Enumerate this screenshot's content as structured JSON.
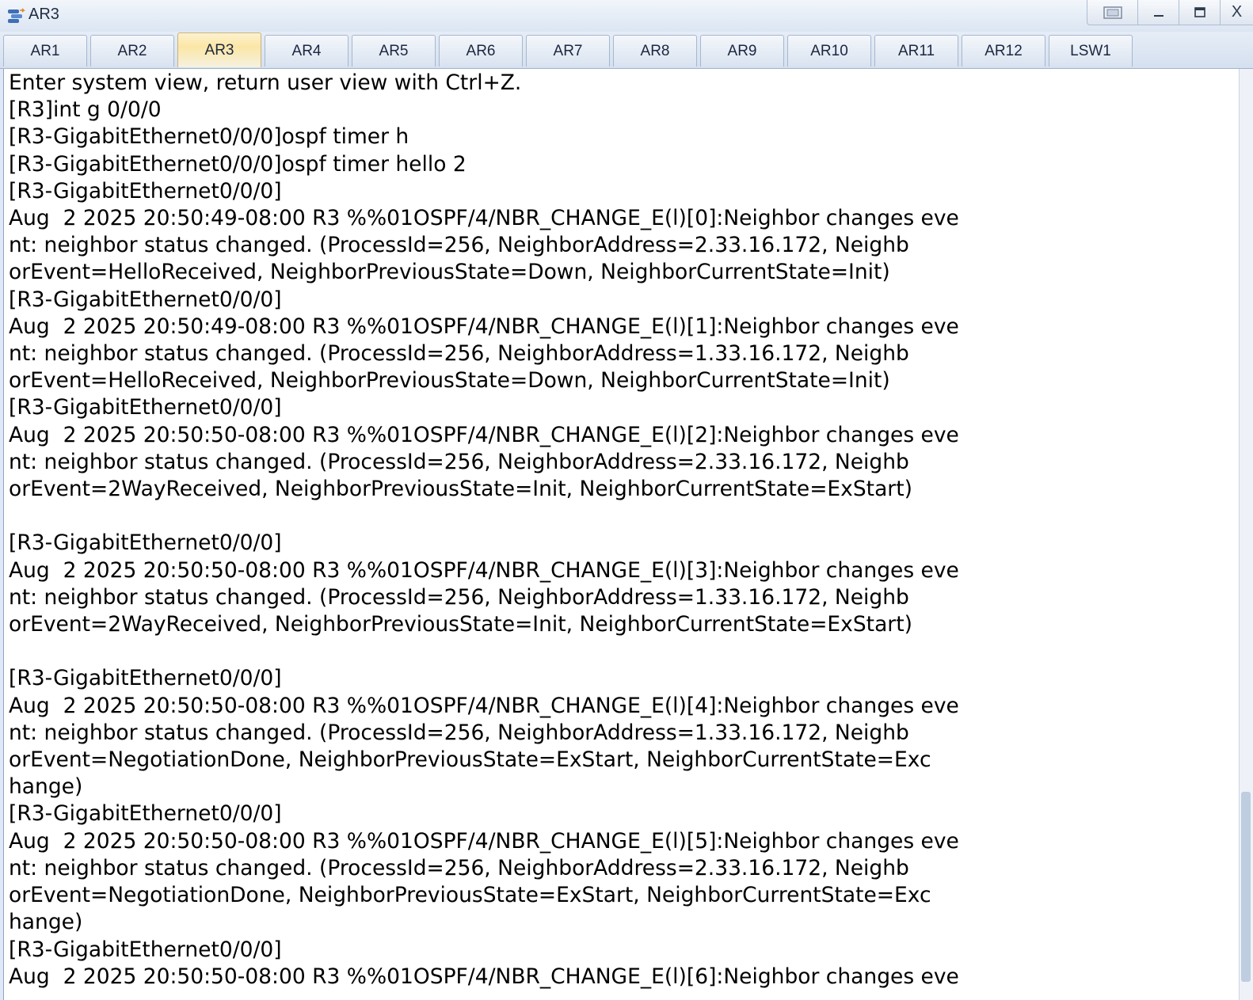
{
  "window": {
    "title": "AR3",
    "icon": "router-icon"
  },
  "window_controls": {
    "restore_icon": "restore-icon",
    "minimize_icon": "minimize-icon",
    "maximize_icon": "maximize-icon",
    "close_label": "X"
  },
  "tabs": [
    {
      "label": "AR1",
      "active": false
    },
    {
      "label": "AR2",
      "active": false
    },
    {
      "label": "AR3",
      "active": true
    },
    {
      "label": "AR4",
      "active": false
    },
    {
      "label": "AR5",
      "active": false
    },
    {
      "label": "AR6",
      "active": false
    },
    {
      "label": "AR7",
      "active": false
    },
    {
      "label": "AR8",
      "active": false
    },
    {
      "label": "AR9",
      "active": false
    },
    {
      "label": "AR10",
      "active": false
    },
    {
      "label": "AR11",
      "active": false
    },
    {
      "label": "AR12",
      "active": false
    },
    {
      "label": "LSW1",
      "active": false
    }
  ],
  "colors": {
    "active_tab": "#fbe6a6",
    "console_background": "#ffffff",
    "console_text": "#000000"
  },
  "console": {
    "lines": [
      "Enter system view, return user view with Ctrl+Z.",
      "[R3]int g 0/0/0",
      "[R3-GigabitEthernet0/0/0]ospf timer h",
      "[R3-GigabitEthernet0/0/0]ospf timer hello 2",
      "[R3-GigabitEthernet0/0/0]",
      "Aug  2 2025 20:50:49-08:00 R3 %%01OSPF/4/NBR_CHANGE_E(l)[0]:Neighbor changes eve",
      "nt: neighbor status changed. (ProcessId=256, NeighborAddress=2.33.16.172, Neighb",
      "orEvent=HelloReceived, NeighborPreviousState=Down, NeighborCurrentState=Init)",
      "[R3-GigabitEthernet0/0/0]",
      "Aug  2 2025 20:50:49-08:00 R3 %%01OSPF/4/NBR_CHANGE_E(l)[1]:Neighbor changes eve",
      "nt: neighbor status changed. (ProcessId=256, NeighborAddress=1.33.16.172, Neighb",
      "orEvent=HelloReceived, NeighborPreviousState=Down, NeighborCurrentState=Init)",
      "[R3-GigabitEthernet0/0/0]",
      "Aug  2 2025 20:50:50-08:00 R3 %%01OSPF/4/NBR_CHANGE_E(l)[2]:Neighbor changes eve",
      "nt: neighbor status changed. (ProcessId=256, NeighborAddress=2.33.16.172, Neighb",
      "orEvent=2WayReceived, NeighborPreviousState=Init, NeighborCurrentState=ExStart)",
      "",
      "[R3-GigabitEthernet0/0/0]",
      "Aug  2 2025 20:50:50-08:00 R3 %%01OSPF/4/NBR_CHANGE_E(l)[3]:Neighbor changes eve",
      "nt: neighbor status changed. (ProcessId=256, NeighborAddress=1.33.16.172, Neighb",
      "orEvent=2WayReceived, NeighborPreviousState=Init, NeighborCurrentState=ExStart)",
      "",
      "[R3-GigabitEthernet0/0/0]",
      "Aug  2 2025 20:50:50-08:00 R3 %%01OSPF/4/NBR_CHANGE_E(l)[4]:Neighbor changes eve",
      "nt: neighbor status changed. (ProcessId=256, NeighborAddress=1.33.16.172, Neighb",
      "orEvent=NegotiationDone, NeighborPreviousState=ExStart, NeighborCurrentState=Exc",
      "hange)",
      "[R3-GigabitEthernet0/0/0]",
      "Aug  2 2025 20:50:50-08:00 R3 %%01OSPF/4/NBR_CHANGE_E(l)[5]:Neighbor changes eve",
      "nt: neighbor status changed. (ProcessId=256, NeighborAddress=2.33.16.172, Neighb",
      "orEvent=NegotiationDone, NeighborPreviousState=ExStart, NeighborCurrentState=Exc",
      "hange)",
      "[R3-GigabitEthernet0/0/0]",
      "Aug  2 2025 20:50:50-08:00 R3 %%01OSPF/4/NBR_CHANGE_E(l)[6]:Neighbor changes eve"
    ]
  }
}
